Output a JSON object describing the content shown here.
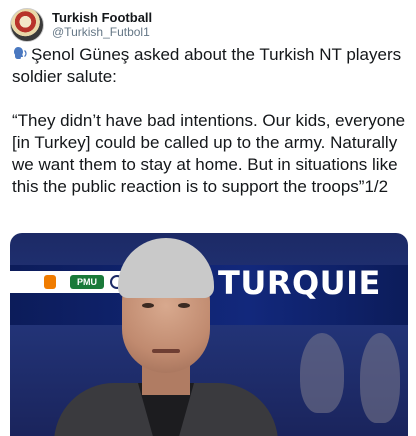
{
  "tweet": {
    "display_name": "Turkish Football",
    "handle": "@Turkish_Futbol1",
    "speaker_icon": "speaking-head-icon",
    "line1": "Şenol Güneş asked about the Turkish NT players soldier salute:",
    "quote": "“They didn’t have bad intentions. Our kids, everyone [in Turkey] could be called up to the army. Naturally we want them to stay at home. But in situations like this the public reaction is to support the troops”1/2"
  },
  "media": {
    "banner_text": "TURQUIE",
    "sponsor_label": "PMU",
    "colors": {
      "banner": "#12287c",
      "sponsor_orange": "#f07c00",
      "sponsor_green": "#1a7a3a"
    }
  }
}
